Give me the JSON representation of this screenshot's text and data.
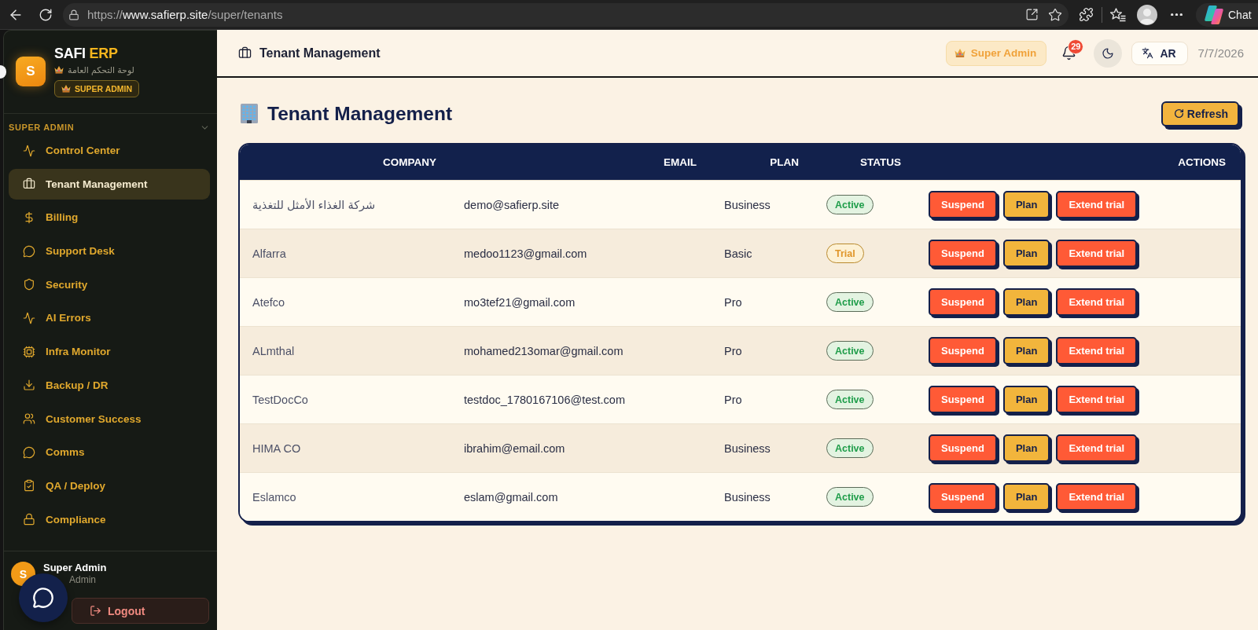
{
  "browser": {
    "url_scheme": "https://",
    "url_host": "www.safierp.site",
    "url_path": "/super/tenants",
    "chat_label": "Chat"
  },
  "sidebar": {
    "brand": {
      "logo_letter": "S",
      "name": "SAFI",
      "name_accent": "ERP",
      "subtitle": "لوحة التحكم العامة",
      "badge": "SUPER ADMIN"
    },
    "sections": [
      {
        "title": "SUPER ADMIN",
        "expanded": true,
        "items": [
          {
            "label": "Control Center",
            "selected": false
          },
          {
            "label": "Tenant Management",
            "selected": true
          },
          {
            "label": "Billing",
            "selected": false
          },
          {
            "label": "Support Desk",
            "selected": false
          },
          {
            "label": "Security",
            "selected": false
          },
          {
            "label": "AI Errors",
            "selected": false
          },
          {
            "label": "Infra Monitor",
            "selected": false
          },
          {
            "label": "Backup / DR",
            "selected": false
          },
          {
            "label": "Customer Success",
            "selected": false
          },
          {
            "label": "Comms",
            "selected": false
          },
          {
            "label": "QA / Deploy",
            "selected": false
          },
          {
            "label": "Compliance",
            "selected": false
          }
        ]
      }
    ],
    "user": {
      "avatar_letter": "S",
      "name": "Super Admin",
      "role": "Admin"
    },
    "logout": "Logout"
  },
  "header": {
    "title": "Tenant Management",
    "role_badge": "Super Admin",
    "notification_count": "29",
    "language": "AR",
    "date": "7/7/2026"
  },
  "page": {
    "title": "Tenant Management",
    "refresh": "Refresh"
  },
  "table": {
    "columns": [
      "COMPANY",
      "EMAIL",
      "PLAN",
      "STATUS",
      "ACTIONS"
    ],
    "rows": [
      {
        "company": "شركة الغذاء الأمثل للتغذية",
        "email": "demo@safierp.site",
        "plan": "Business",
        "status": {
          "label": "Active",
          "kind": "active"
        },
        "actions": [
          {
            "label": "Suspend",
            "kind": "danger"
          },
          {
            "label": "Plan",
            "kind": "warning"
          },
          {
            "label": "Extend trial",
            "kind": "danger"
          }
        ]
      },
      {
        "company": "Alfarra",
        "email": "medoo1123@gmail.com",
        "plan": "Basic",
        "status": {
          "label": "Trial",
          "kind": "trial"
        },
        "actions": [
          {
            "label": "Suspend",
            "kind": "danger"
          },
          {
            "label": "Plan",
            "kind": "warning"
          },
          {
            "label": "Extend trial",
            "kind": "danger"
          }
        ]
      },
      {
        "company": "Atefco",
        "email": "mo3tef21@gmail.com",
        "plan": "Pro",
        "status": {
          "label": "Active",
          "kind": "active"
        },
        "actions": [
          {
            "label": "Suspend",
            "kind": "danger"
          },
          {
            "label": "Plan",
            "kind": "warning"
          },
          {
            "label": "Extend trial",
            "kind": "danger"
          }
        ]
      },
      {
        "company": "ALmthal",
        "email": "mohamed213omar@gmail.com",
        "plan": "Pro",
        "status": {
          "label": "Active",
          "kind": "active"
        },
        "actions": [
          {
            "label": "Suspend",
            "kind": "danger"
          },
          {
            "label": "Plan",
            "kind": "warning"
          },
          {
            "label": "Extend trial",
            "kind": "danger"
          }
        ]
      },
      {
        "company": "TestDocCo",
        "email": "testdoc_1780167106@test.com",
        "plan": "Pro",
        "status": {
          "label": "Active",
          "kind": "active"
        },
        "actions": [
          {
            "label": "Suspend",
            "kind": "danger"
          },
          {
            "label": "Plan",
            "kind": "warning"
          },
          {
            "label": "Extend trial",
            "kind": "danger"
          }
        ]
      },
      {
        "company": "HIMA CO",
        "email": "ibrahim@email.com",
        "plan": "Business",
        "status": {
          "label": "Active",
          "kind": "active"
        },
        "actions": [
          {
            "label": "Suspend",
            "kind": "danger"
          },
          {
            "label": "Plan",
            "kind": "warning"
          },
          {
            "label": "Extend trial",
            "kind": "danger"
          }
        ]
      },
      {
        "company": "Eslamco",
        "email": "eslam@gmail.com",
        "plan": "Business",
        "status": {
          "label": "Active",
          "kind": "active"
        },
        "actions": [
          {
            "label": "Suspend",
            "kind": "danger"
          },
          {
            "label": "Plan",
            "kind": "warning"
          },
          {
            "label": "Extend trial",
            "kind": "danger"
          }
        ]
      }
    ]
  }
}
